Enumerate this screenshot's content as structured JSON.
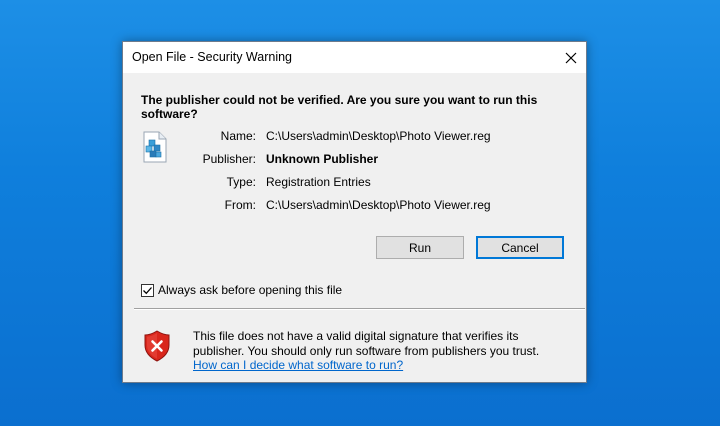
{
  "window": {
    "title": "Open File - Security Warning"
  },
  "warning": {
    "headline": "The publisher could not be verified.  Are you sure you want to run this software?"
  },
  "file_info": {
    "name_label": "Name:",
    "name_value": "C:\\Users\\admin\\Desktop\\Photo Viewer.reg",
    "publisher_label": "Publisher:",
    "publisher_value": "Unknown Publisher",
    "type_label": "Type:",
    "type_value": "Registration Entries",
    "from_label": "From:",
    "from_value": "C:\\Users\\admin\\Desktop\\Photo Viewer.reg"
  },
  "buttons": {
    "run_label": "Run",
    "cancel_label": "Cancel"
  },
  "checkbox": {
    "label": "Always ask before opening this file",
    "checked": true
  },
  "footer": {
    "message": "This file does not have a valid digital signature that verifies its publisher.  You should only run software from publishers you trust.",
    "link_text": "How can I decide what software to run?"
  },
  "colors": {
    "desktop_background": "#0f7fdc",
    "dialog_background": "#f0f0f0",
    "default_button_border": "#0078d7",
    "link": "#0066cc",
    "shield_red": "#d9261c"
  },
  "icons": {
    "file_icon": "registry-file-icon",
    "shield_icon": "security-shield-error-icon",
    "close_icon": "close-icon",
    "check_icon": "checkmark-icon"
  }
}
